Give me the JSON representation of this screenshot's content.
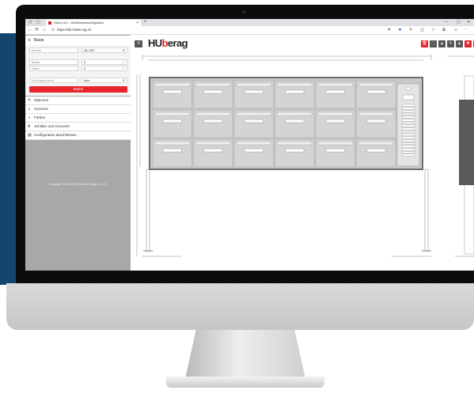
{
  "browser": {
    "tab_title": "Huber AG – Briefkastenkonfigurator",
    "tab_close": "×",
    "new_tab": "+",
    "url": "https://bk.huber-ag.ch",
    "nav_back": "←",
    "nav_forward": "→",
    "nav_reload": "⟳",
    "nav_home": "⌂"
  },
  "sidebar": {
    "section_title": "Basis",
    "fields": [
      {
        "label": "Modell",
        "value": "Alu 250",
        "control": "⬍"
      },
      {
        "label": "Breite",
        "value": "6",
        "control": "- +"
      },
      {
        "label": "Höhe",
        "value": "3",
        "control": "- +"
      },
      {
        "label": "Durchgehend ●",
        "value": "nein",
        "control": "⬍"
      }
    ],
    "continue_button": "Weiter",
    "menu": [
      {
        "icon": "✎",
        "label": "Optionen"
      },
      {
        "icon": "♫",
        "label": "Sonnerie"
      },
      {
        "icon": "◑",
        "label": "Farben"
      },
      {
        "icon": "A",
        "label": "Schilder und Gravuren"
      },
      {
        "icon": "▤",
        "label": "Konfiguration abschliessen"
      }
    ],
    "copyright": "Copyright ©2016-2023 Fitness Design · v12.9"
  },
  "app": {
    "logo_dark_1": "HU",
    "logo_red": "b",
    "logo_dark_2": "erag",
    "menu_icon": "≡",
    "toolbar": [
      {
        "icon": "🗑",
        "color": "#e5242b"
      },
      {
        "icon": "⛶",
        "color": "#555555"
      },
      {
        "icon": "▲",
        "color": "#555555"
      },
      {
        "icon": "✎",
        "color": "#555555"
      },
      {
        "icon": "▲",
        "color": "#555555"
      },
      {
        "icon": "✖",
        "color": "#e5242b"
      },
      {
        "icon": "⚙",
        "color": "#e5242b"
      }
    ]
  },
  "drawing": {
    "columns": 6,
    "rows": 3,
    "panel_color": "#d4d4d4",
    "frame_color": "#6e6e6e",
    "side_view_color": "#595959"
  }
}
